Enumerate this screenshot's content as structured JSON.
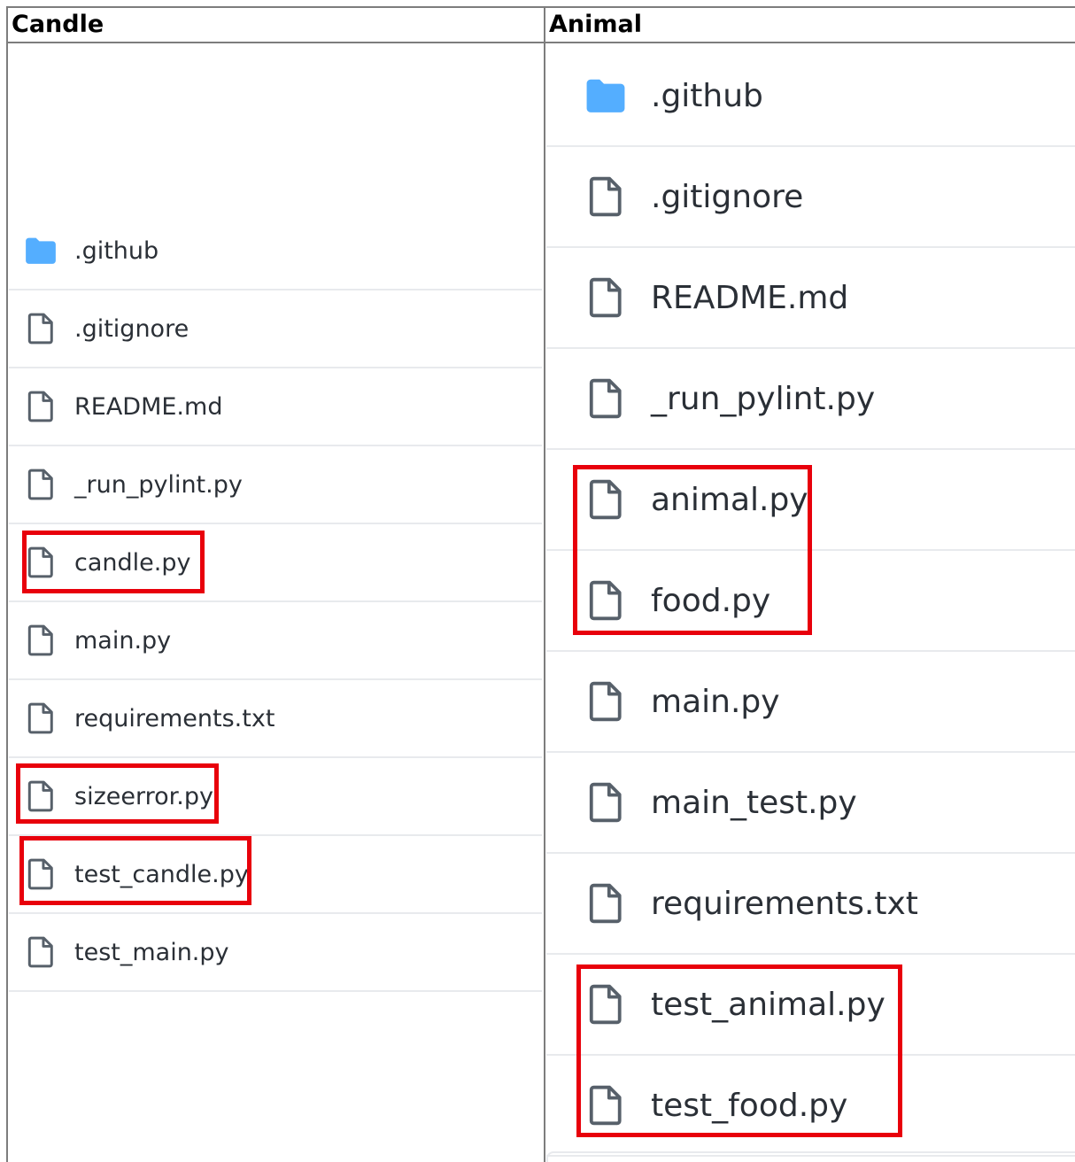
{
  "headers": {
    "left": "Candle",
    "right": "Animal"
  },
  "colors": {
    "folder": "#54aeff",
    "file_icon": "#57606a",
    "highlight": "#e8000b",
    "divider": "#e8eaed"
  },
  "left_files": [
    {
      "name": ".github",
      "icon": "folder-icon"
    },
    {
      "name": ".gitignore",
      "icon": "file-icon"
    },
    {
      "name": "README.md",
      "icon": "file-icon"
    },
    {
      "name": "_run_pylint.py",
      "icon": "file-icon"
    },
    {
      "name": "candle.py",
      "icon": "file-icon",
      "highlighted": true
    },
    {
      "name": "main.py",
      "icon": "file-icon"
    },
    {
      "name": "requirements.txt",
      "icon": "file-icon"
    },
    {
      "name": "sizeerror.py",
      "icon": "file-icon",
      "highlighted": true
    },
    {
      "name": "test_candle.py",
      "icon": "file-icon",
      "highlighted": true
    },
    {
      "name": "test_main.py",
      "icon": "file-icon"
    }
  ],
  "right_files": [
    {
      "name": ".github",
      "icon": "folder-icon"
    },
    {
      "name": ".gitignore",
      "icon": "file-icon"
    },
    {
      "name": "README.md",
      "icon": "file-icon"
    },
    {
      "name": "_run_pylint.py",
      "icon": "file-icon"
    },
    {
      "name": "animal.py",
      "icon": "file-icon",
      "highlighted": true
    },
    {
      "name": "food.py",
      "icon": "file-icon",
      "highlighted": true
    },
    {
      "name": "main.py",
      "icon": "file-icon"
    },
    {
      "name": "main_test.py",
      "icon": "file-icon"
    },
    {
      "name": "requirements.txt",
      "icon": "file-icon"
    },
    {
      "name": "test_animal.py",
      "icon": "file-icon",
      "highlighted": true
    },
    {
      "name": "test_food.py",
      "icon": "file-icon",
      "highlighted": true
    }
  ]
}
